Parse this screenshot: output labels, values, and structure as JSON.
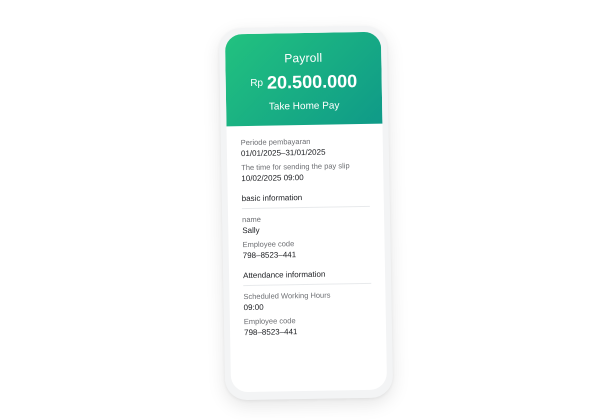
{
  "header": {
    "title": "Payroll",
    "currency": "Rp",
    "amount": "20.500.000",
    "subtitle": "Take Home Pay",
    "gradient_start": "#22c27f",
    "gradient_end": "#0f9a88"
  },
  "period": {
    "label": "Periode pembayaran",
    "value": "01/01/2025–31/01/2025"
  },
  "send_time": {
    "label": "The time for sending the pay slip",
    "value": "10/02/2025 09:00"
  },
  "basic": {
    "title": "basic information",
    "name_label": "name",
    "name_value": "Sally",
    "code_label": "Employee code",
    "code_value": "798–8523–441"
  },
  "attendance": {
    "title": "Attendance information",
    "hours_label": "Scheduled Working Hours",
    "hours_value": "09:00",
    "code_label": "Employee code",
    "code_value": "798–8523–441"
  }
}
